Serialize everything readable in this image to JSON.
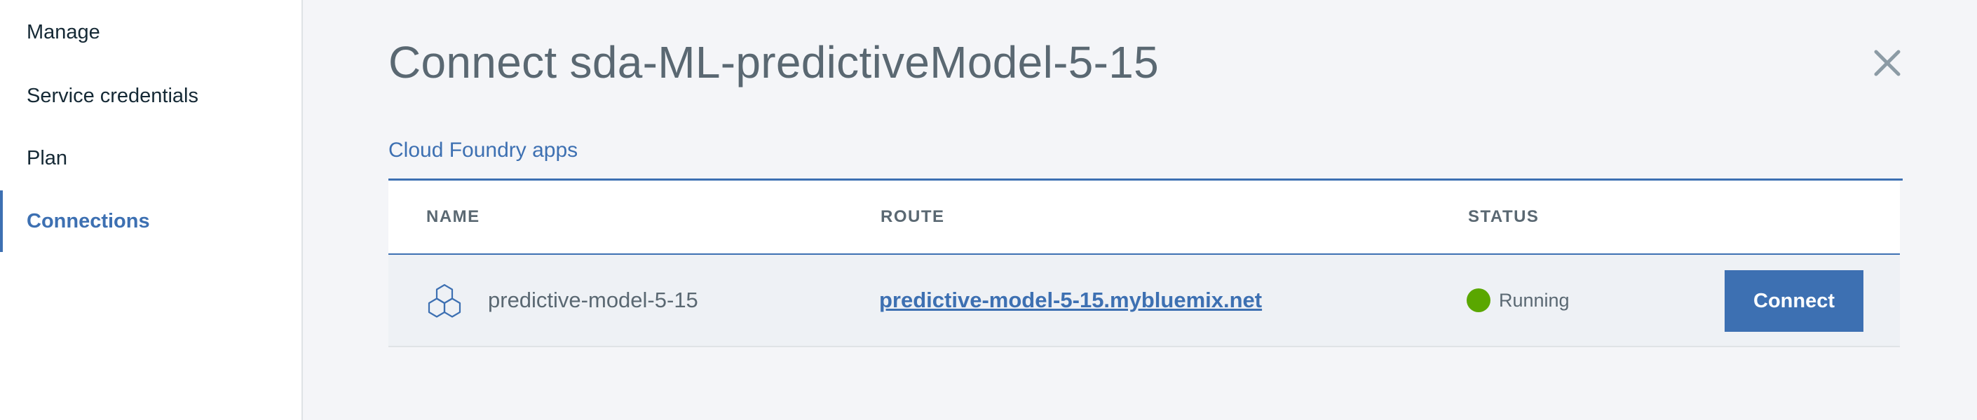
{
  "sidebar": {
    "items": [
      {
        "label": "Manage",
        "active": false
      },
      {
        "label": "Service credentials",
        "active": false
      },
      {
        "label": "Plan",
        "active": false
      },
      {
        "label": "Connections",
        "active": true
      }
    ]
  },
  "dialog": {
    "title": "Connect sda-ML-predictiveModel-5-15",
    "close_icon": "close-icon",
    "tab_label": "Cloud Foundry apps"
  },
  "table": {
    "columns": [
      "NAME",
      "ROUTE",
      "STATUS"
    ],
    "rows": [
      {
        "icon": "cloud-foundry-app-icon",
        "name": "predictive-model-5-15",
        "route": "predictive-model-5-15.mybluemix.net",
        "status": "Running",
        "status_color": "#5aa700",
        "action_label": "Connect"
      }
    ]
  },
  "colors": {
    "accent": "#3d70b2",
    "background": "#f4f5f8",
    "text_muted": "#5a6872"
  }
}
